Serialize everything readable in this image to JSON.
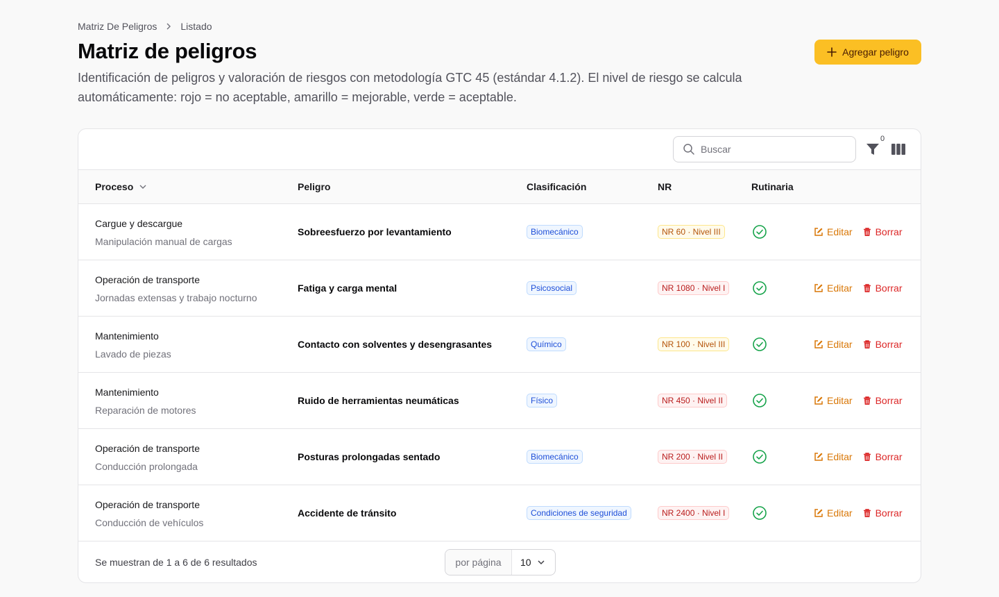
{
  "breadcrumb": {
    "parent": "Matriz De Peligros",
    "current": "Listado"
  },
  "page": {
    "title": "Matriz de peligros",
    "subtitle": "Identificación de peligros y valoración de riesgos con metodología GTC 45 (estándar 4.1.2). El nivel de riesgo se calcula automáticamente: rojo = no aceptable, amarillo = mejorable, verde = aceptable.",
    "add_button_label": "Agregar peligro"
  },
  "toolbar": {
    "search_placeholder": "Buscar",
    "filter_count": "0"
  },
  "table": {
    "headers": {
      "proceso": "Proceso",
      "peligro": "Peligro",
      "clasificacion": "Clasificación",
      "nr": "NR",
      "rutinaria": "Rutinaria"
    },
    "rows": [
      {
        "proceso": "Cargue y descargue",
        "actividad": "Manipulación manual de cargas",
        "peligro": "Sobreesfuerzo por levantamiento",
        "clasificacion": "Biomecánico",
        "nr": "NR 60 · Nivel III",
        "nr_level": "amber",
        "rutinaria": true,
        "edit": "Editar",
        "delete": "Borrar"
      },
      {
        "proceso": "Operación de transporte",
        "actividad": "Jornadas extensas y trabajo nocturno",
        "peligro": "Fatiga y carga mental",
        "clasificacion": "Psicosocial",
        "nr": "NR 1080 · Nivel I",
        "nr_level": "red",
        "rutinaria": true,
        "edit": "Editar",
        "delete": "Borrar"
      },
      {
        "proceso": "Mantenimiento",
        "actividad": "Lavado de piezas",
        "peligro": "Contacto con solventes y desengrasantes",
        "clasificacion": "Químico",
        "nr": "NR 100 · Nivel III",
        "nr_level": "amber",
        "rutinaria": true,
        "edit": "Editar",
        "delete": "Borrar"
      },
      {
        "proceso": "Mantenimiento",
        "actividad": "Reparación de motores",
        "peligro": "Ruido de herramientas neumáticas",
        "clasificacion": "Físico",
        "nr": "NR 450 · Nivel II",
        "nr_level": "red",
        "rutinaria": true,
        "edit": "Editar",
        "delete": "Borrar"
      },
      {
        "proceso": "Operación de transporte",
        "actividad": "Conducción prolongada",
        "peligro": "Posturas prolongadas sentado",
        "clasificacion": "Biomecánico",
        "nr": "NR 200 · Nivel II",
        "nr_level": "red",
        "rutinaria": true,
        "edit": "Editar",
        "delete": "Borrar"
      },
      {
        "proceso": "Operación de transporte",
        "actividad": "Conducción de vehículos",
        "peligro": "Accidente de tránsito",
        "clasificacion": "Condiciones de seguridad",
        "nr": "NR 2400 · Nivel I",
        "nr_level": "red",
        "rutinaria": true,
        "edit": "Editar",
        "delete": "Borrar"
      }
    ]
  },
  "footer": {
    "results_text": "Se muestran de 1 a 6 de 6 resultados",
    "per_page_label": "por página",
    "per_page_value": "10"
  },
  "colors": {
    "accent": "#fbbf24",
    "edit": "#d97706",
    "delete": "#dc2626",
    "check": "#16a34a"
  }
}
